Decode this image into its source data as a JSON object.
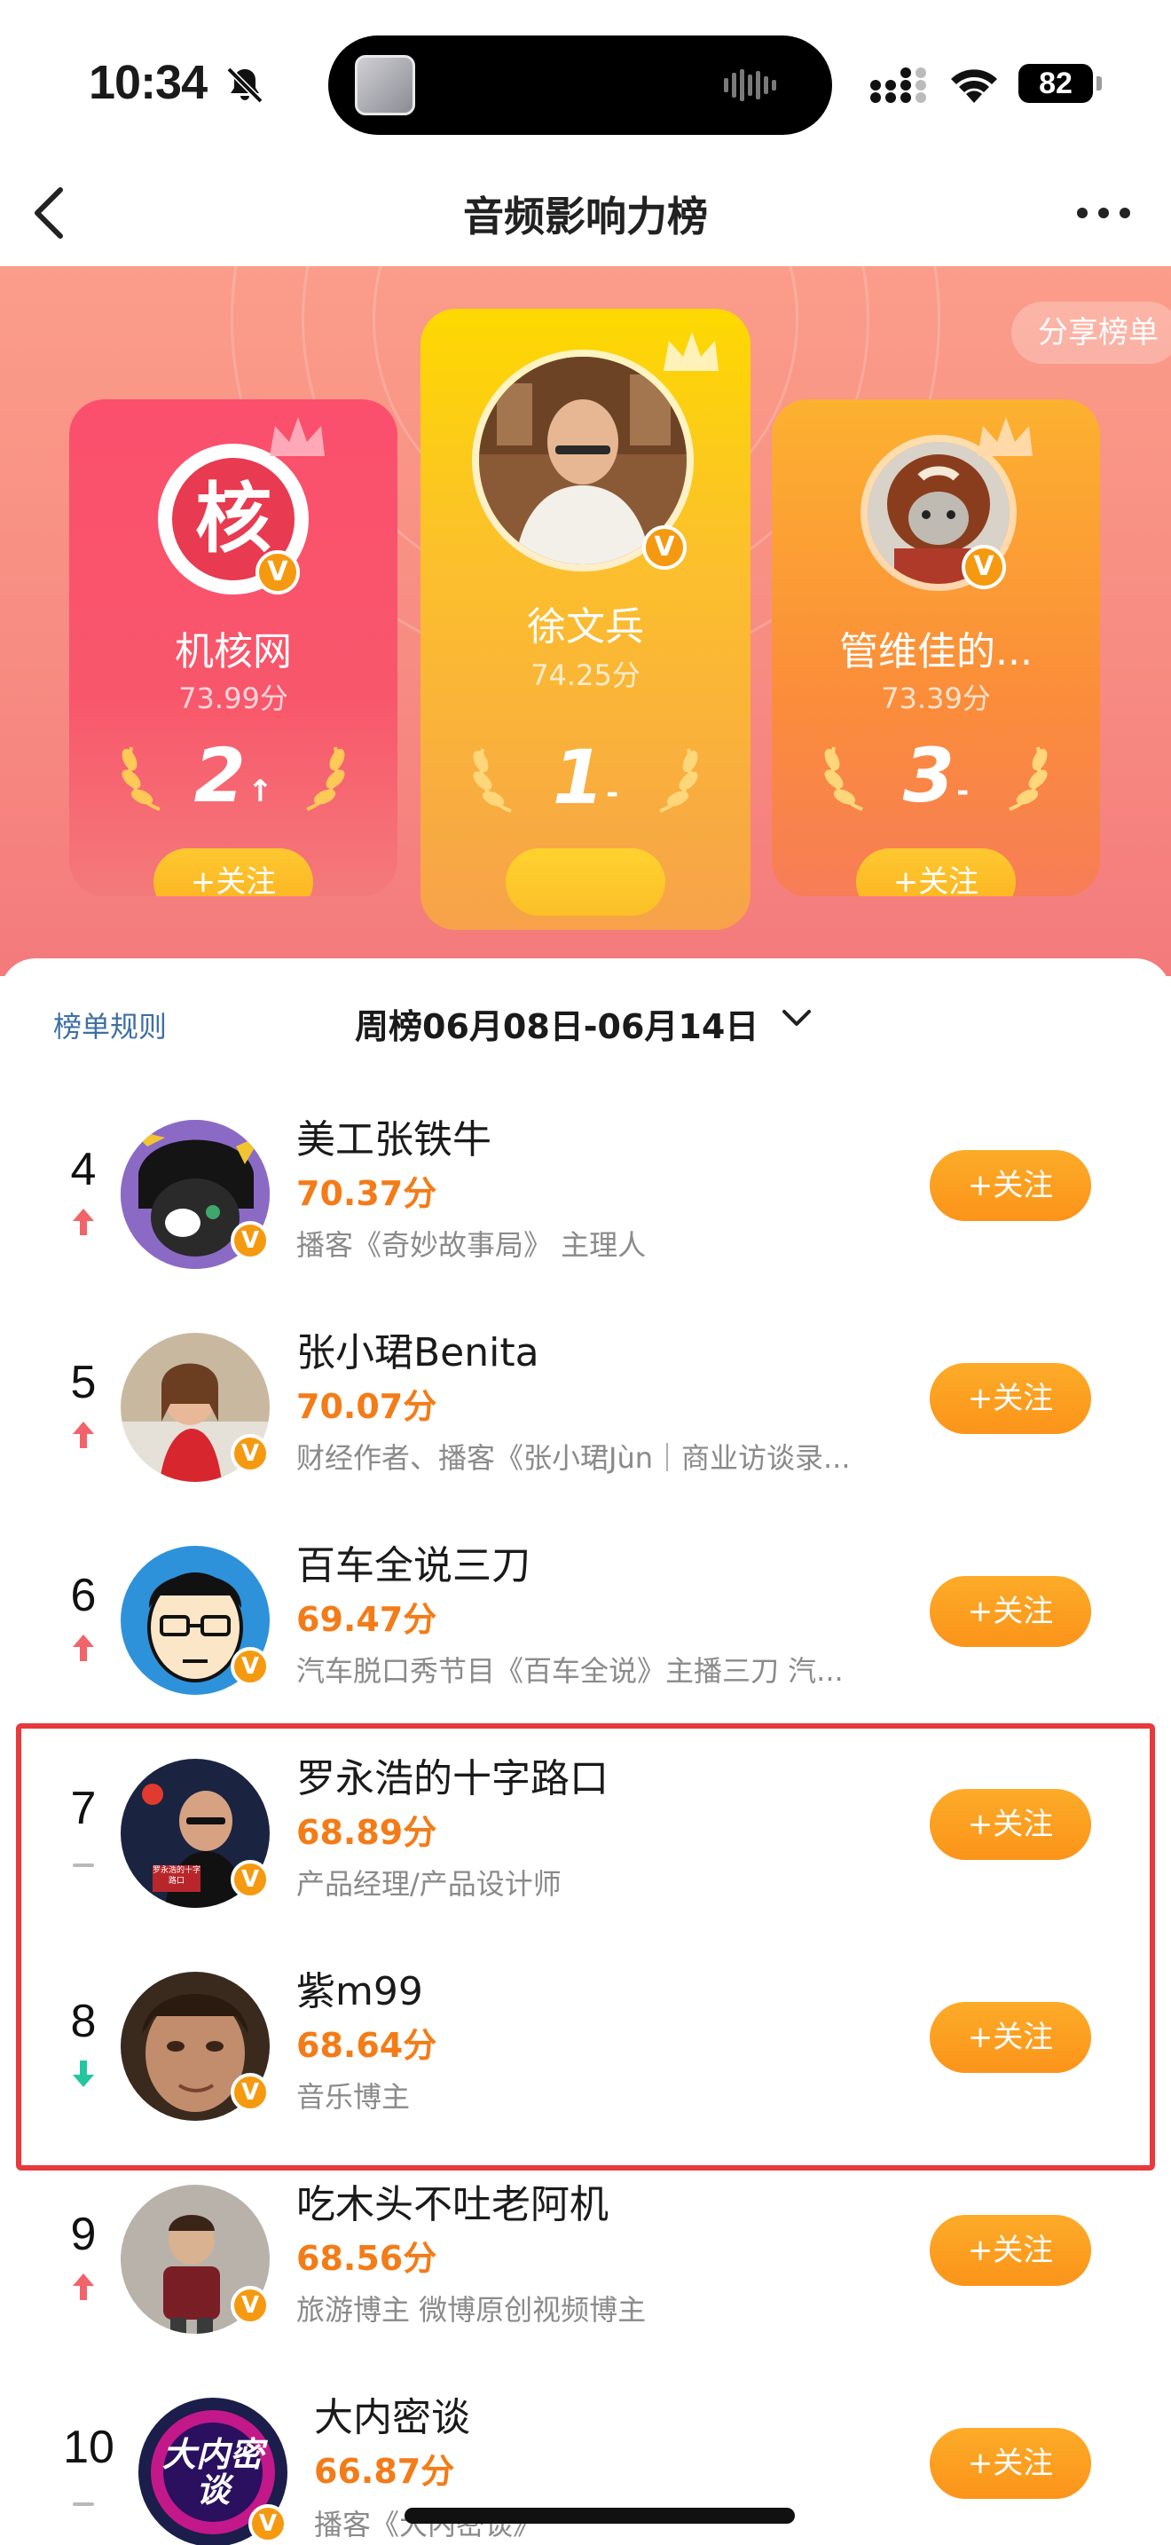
{
  "status": {
    "time": "10:34",
    "battery": "82"
  },
  "nav": {
    "title": "音频影响力榜"
  },
  "hero": {
    "share_label": "分享榜单",
    "top3": [
      {
        "rank": "2",
        "trend": "up",
        "name": "机核网",
        "score": "73.99分",
        "follow": "+关注",
        "avatar_text": "核"
      },
      {
        "rank": "1",
        "trend": "same",
        "name": "徐文兵",
        "score": "74.25分",
        "follow": ""
      },
      {
        "rank": "3",
        "trend": "same",
        "name": "管维佳的...",
        "score": "73.39分",
        "follow": "+关注"
      }
    ]
  },
  "list": {
    "rules_label": "榜单规则",
    "week_label": "周榜06月08日-06月14日",
    "items": [
      {
        "rank": "4",
        "trend": "up",
        "name": "美工张铁牛",
        "score": "70.37分",
        "desc": "播客《奇妙故事局》 主理人",
        "follow": "+关注"
      },
      {
        "rank": "5",
        "trend": "up",
        "name": "张小珺Benita",
        "score": "70.07分",
        "desc": "财经作者、播客《张小珺Jùn｜商业访谈录...",
        "follow": "+关注"
      },
      {
        "rank": "6",
        "trend": "up",
        "name": "百车全说三刀",
        "score": "69.47分",
        "desc": "汽车脱口秀节目《百车全说》主播三刀 汽...",
        "follow": "+关注"
      },
      {
        "rank": "7",
        "trend": "same",
        "name": "罗永浩的十字路口",
        "score": "68.89分",
        "desc": "产品经理/产品设计师",
        "follow": "+关注",
        "avatar_text": "罗永浩的十字路口"
      },
      {
        "rank": "8",
        "trend": "down",
        "name": "紫m99",
        "score": "68.64分",
        "desc": "音乐博主",
        "follow": "+关注"
      },
      {
        "rank": "9",
        "trend": "up",
        "name": "吃木头不吐老阿机",
        "score": "68.56分",
        "desc": "旅游博主 微博原创视频博主",
        "follow": "+关注"
      },
      {
        "rank": "10",
        "trend": "same",
        "name": "大内密谈",
        "score": "66.87分",
        "desc": "播客《大内密谈》",
        "follow": "+关注",
        "avatar_text": "大内密谈"
      }
    ]
  },
  "colors": {
    "accent": "#f37c18",
    "follow": "#fb9c20",
    "highlight": "#e8393c",
    "up": "#f2636a",
    "down": "#23c6a1"
  }
}
